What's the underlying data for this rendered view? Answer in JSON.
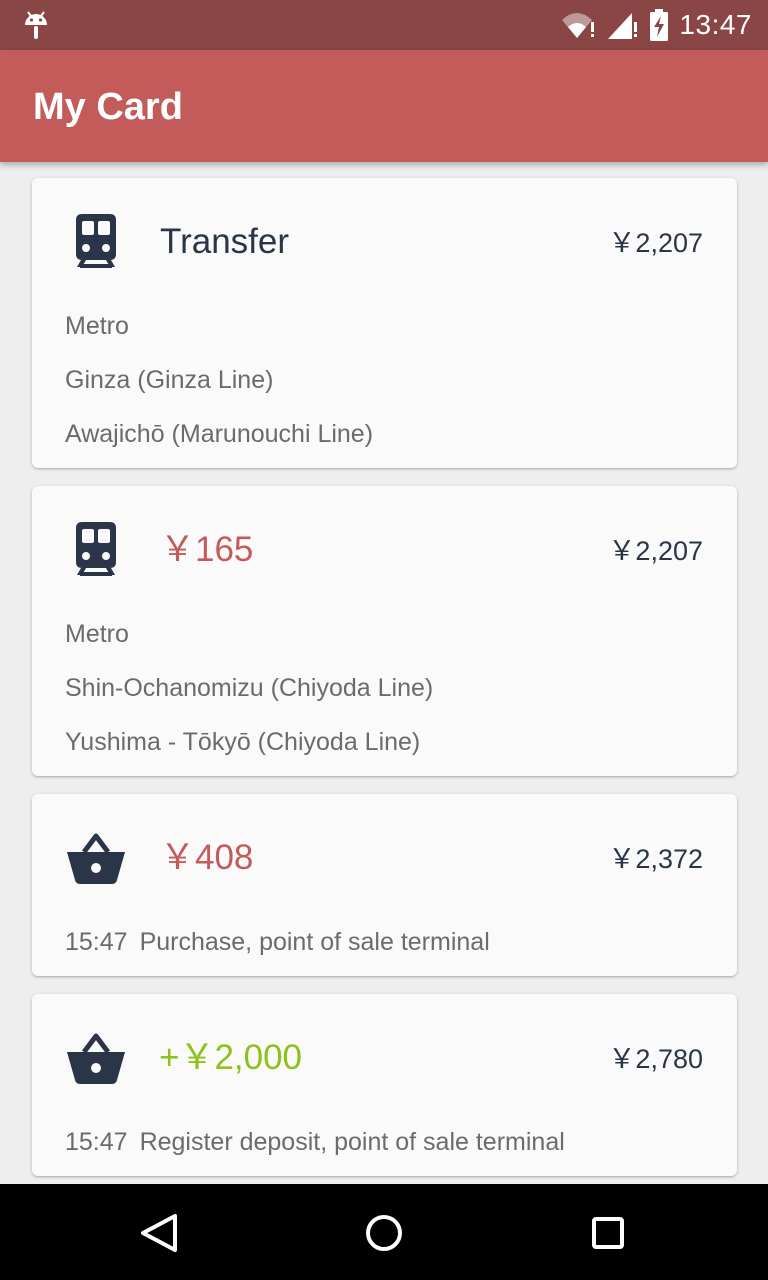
{
  "status_bar": {
    "time": "13:47",
    "icons": [
      "android-icon",
      "wifi-icon",
      "signal-icon",
      "battery-charging-icon"
    ]
  },
  "app_bar": {
    "title": "My Card"
  },
  "cards": [
    {
      "icon": "train-icon",
      "primary": "Transfer",
      "balance": "￥2,207",
      "lines": [
        "Metro",
        "Ginza (Ginza Line)",
        "Awajichō (Marunouchi Line)"
      ]
    },
    {
      "icon": "train-icon",
      "primary": "￥165",
      "balance": "￥2,207",
      "lines": [
        "Metro",
        "Shin-Ochanomizu (Chiyoda Line)",
        "Yushima - Tōkyō (Chiyoda Line)"
      ]
    },
    {
      "icon": "basket-icon",
      "primary": "￥408",
      "balance": "￥2,372",
      "time": "15:47",
      "description": "Purchase, point of sale terminal"
    },
    {
      "icon": "basket-icon",
      "primary": "+￥2,000",
      "balance": "￥2,780",
      "time": "15:47",
      "description": "Register deposit, point of sale terminal"
    }
  ],
  "colors": {
    "status_bar": "#8a4545",
    "app_bar": "#c45b5b",
    "negative_amount": "#c45b5b",
    "positive_amount": "#8cc21b",
    "text_dark": "#2b3548",
    "text_secondary": "#6b6b6b"
  },
  "nav_bar": {
    "buttons": [
      "back-icon",
      "home-icon",
      "recents-icon"
    ]
  }
}
